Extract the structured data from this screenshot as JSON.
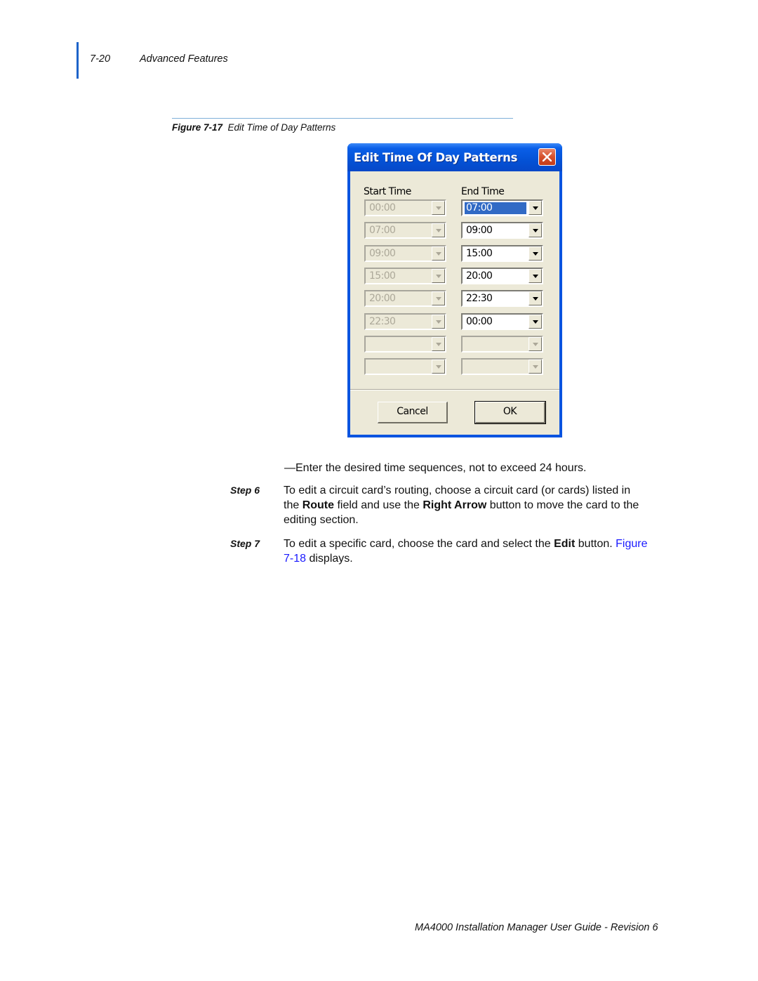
{
  "header": {
    "page_number": "7-20",
    "section_title": "Advanced Features"
  },
  "figure": {
    "label": "Figure 7-17",
    "title": "Edit Time of Day Patterns"
  },
  "dialog": {
    "title": "Edit Time Of Day Patterns",
    "close_icon": "close-icon",
    "start_time_label": "Start Time",
    "end_time_label": "End Time",
    "rows": [
      {
        "start": "00:00",
        "end": "07:00",
        "end_selected": true
      },
      {
        "start": "07:00",
        "end": "09:00"
      },
      {
        "start": "09:00",
        "end": "15:00"
      },
      {
        "start": "15:00",
        "end": "20:00"
      },
      {
        "start": "20:00",
        "end": "22:30"
      },
      {
        "start": "22:30",
        "end": "00:00"
      },
      {
        "start": "",
        "end": "",
        "end_disabled": true
      },
      {
        "start": "",
        "end": "",
        "end_disabled": true
      }
    ],
    "cancel_label": "Cancel",
    "ok_label": "OK"
  },
  "body": {
    "note": "—Enter the desired time sequences, not to exceed 24 hours.",
    "step6": {
      "label": "Step 6",
      "text_1": "To edit a circuit card’s routing, choose a circuit card (or cards) listed in",
      "text_2a": "the ",
      "bold_route": "Route",
      "text_2b": " field and use the ",
      "bold_right_arrow": "Right Arrow",
      "text_2c": " button to move the card to the",
      "text_3": "editing section."
    },
    "step7": {
      "label": "Step 7",
      "text_1a": "To edit a specific card, choose the card and select the ",
      "bold_edit": "Edit",
      "text_1b": " button. ",
      "link_1": "Figure",
      "link_2": "7-18",
      "text_2": " displays."
    }
  },
  "footer": {
    "text": "MA4000 Installation Manager User Guide - Revision 6"
  },
  "colors": {
    "accent_bar": "#1d63c9",
    "link": "#1a1aff",
    "titlebar": "#0452d6",
    "dialog_face": "#ece9d8",
    "selection": "#316ac5"
  }
}
